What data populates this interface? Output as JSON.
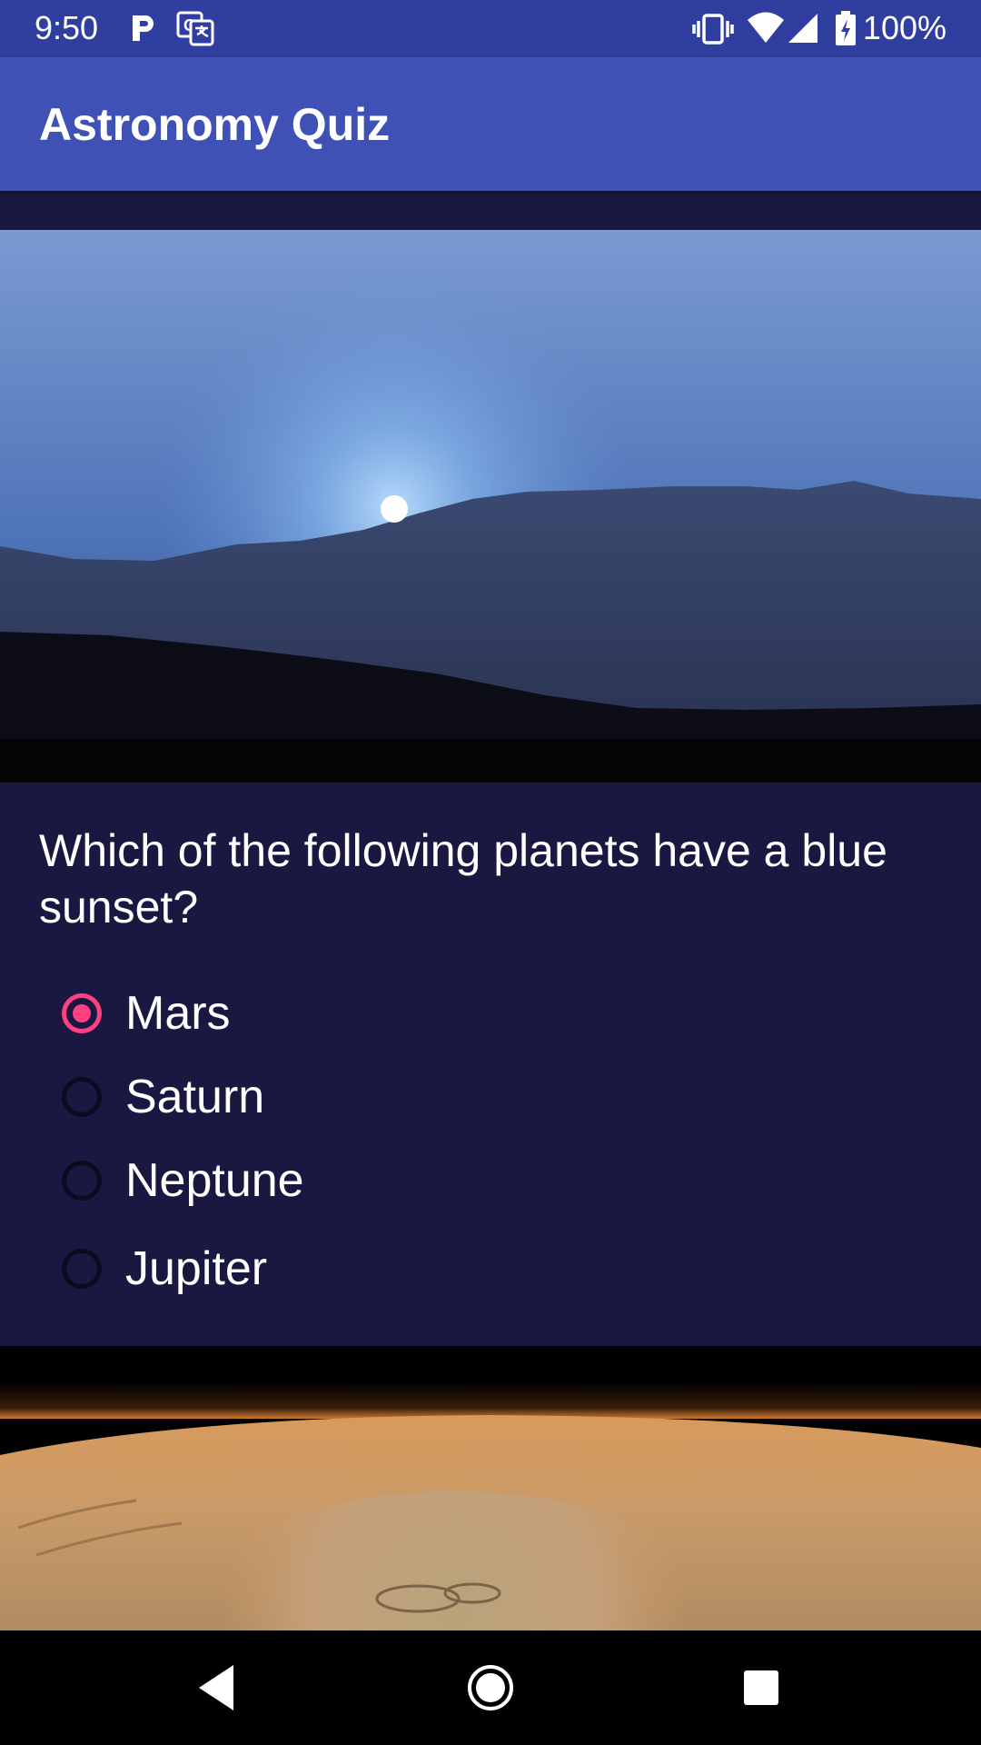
{
  "status_bar": {
    "time": "9:50",
    "battery": "100%",
    "icons": [
      "parking-icon",
      "translate-icon",
      "vibrate-icon",
      "wifi-icon",
      "signal-icon",
      "battery-icon"
    ]
  },
  "app_bar": {
    "title": "Astronomy Quiz"
  },
  "quiz": {
    "question": "Which of the following planets have a blue sunset?",
    "options": [
      {
        "label": "Mars",
        "selected": true
      },
      {
        "label": "Saturn",
        "selected": false
      },
      {
        "label": "Neptune",
        "selected": false
      },
      {
        "label": "Jupiter",
        "selected": false
      }
    ]
  },
  "colors": {
    "status_bar": "#303f9f",
    "app_bar": "#3f51b5",
    "background": "#1a1840",
    "accent": "#ff4081"
  },
  "nav_bar": {
    "icons": [
      "back-icon",
      "home-icon",
      "recents-icon"
    ]
  }
}
